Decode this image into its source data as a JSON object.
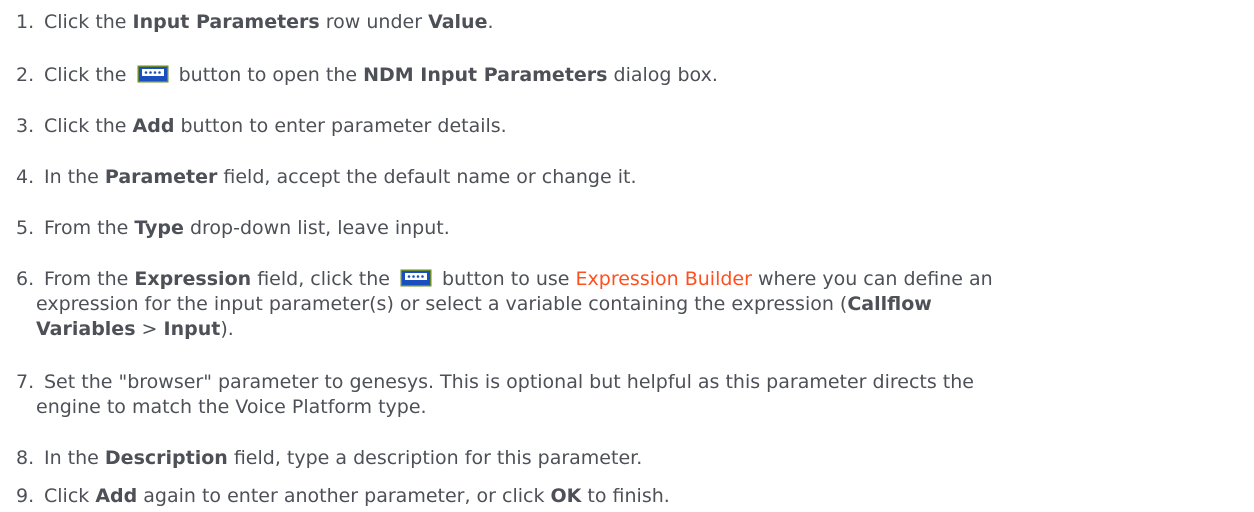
{
  "steps": [
    {
      "num": "1.",
      "a": "Click the ",
      "b1": "Input Parameters",
      "c": " row under ",
      "b2": "Value",
      "d": "."
    },
    {
      "num": "2.",
      "a": "Click the ",
      "c": " button to open the ",
      "b1": "NDM Input Parameters",
      "d": " dialog box."
    },
    {
      "num": "3.",
      "a": "Click the ",
      "b1": "Add",
      "c": " button to enter parameter details."
    },
    {
      "num": "4.",
      "a": "In the ",
      "b1": "Parameter",
      "c": " field, accept the default name or change it."
    },
    {
      "num": "5.",
      "a": "From the ",
      "b1": "Type",
      "c": " drop-down list, leave input."
    },
    {
      "num": "6.",
      "a": "From the ",
      "b1": "Expression",
      "c": " field, click the ",
      "d": " button to use ",
      "link": "Expression Builder",
      "e": " where you can define an",
      "line2": "expression for the input parameter(s) or select a variable containing the expression (",
      "b2": "Callflow",
      "b3": "Variables",
      "f": " > ",
      "b4": "Input",
      "g": ")."
    },
    {
      "num": "7.",
      "line1": "Set the \"browser\" parameter to genesys. This is optional but helpful as this parameter directs the",
      "line2": "engine to match the Voice Platform type."
    },
    {
      "num": "8.",
      "a": "In the ",
      "b1": "Description",
      "c": " field, type a description for this parameter."
    },
    {
      "num": "9.",
      "a": "Click ",
      "b1": "Add",
      "c": " again to enter another parameter, or click ",
      "b2": "OK",
      "d": " to finish."
    }
  ],
  "colors": {
    "text": "#4d5157",
    "link": "#ff4f1f",
    "icon_fill": "#1a4fc0",
    "icon_border": "#6b8c2a"
  },
  "icons": {
    "builder_button": "ellipsis-button-icon"
  }
}
